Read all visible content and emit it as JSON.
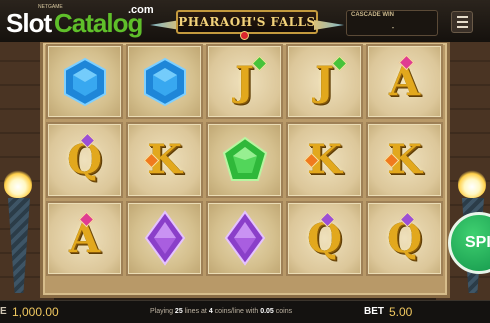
{
  "logo": {
    "word1": "Slot",
    "word2": "Catalog",
    "suffix": ".com",
    "tiny": "NETGAME"
  },
  "game": {
    "title": "PHARAOH'S FALLS"
  },
  "cascade": {
    "label": "CASCADE WIN",
    "value": "-"
  },
  "reels": [
    [
      {
        "symbol": "sapphire",
        "kind": "gem",
        "color": "#1e86d8"
      },
      {
        "symbol": "Q",
        "kind": "letter"
      },
      {
        "symbol": "A",
        "kind": "letter"
      }
    ],
    [
      {
        "symbol": "sapphire",
        "kind": "gem",
        "color": "#1e86d8"
      },
      {
        "symbol": "K",
        "kind": "letter"
      },
      {
        "symbol": "amethyst",
        "kind": "gem",
        "color": "#8a3fc9"
      }
    ],
    [
      {
        "symbol": "J",
        "kind": "letter"
      },
      {
        "symbol": "emerald",
        "kind": "gem",
        "color": "#2fb83a"
      },
      {
        "symbol": "amethyst",
        "kind": "gem",
        "color": "#8a3fc9"
      }
    ],
    [
      {
        "symbol": "J",
        "kind": "letter"
      },
      {
        "symbol": "K",
        "kind": "letter"
      },
      {
        "symbol": "Q",
        "kind": "letter"
      }
    ],
    [
      {
        "symbol": "A",
        "kind": "letter"
      },
      {
        "symbol": "K",
        "kind": "letter"
      },
      {
        "symbol": "Q",
        "kind": "letter"
      }
    ]
  ],
  "spin": {
    "label": "SPI"
  },
  "status": {
    "balance_label": "E",
    "balance": "1,000.00",
    "playing_prefix": "Playing",
    "lines": "25",
    "lines_text": "lines at",
    "coins": "4",
    "coins_text": "coins/line with",
    "coin_value": "0.05",
    "coin_suffix": "coins",
    "bet_label": "BET",
    "bet": "5.00"
  },
  "colors": {
    "accent_gold": "#f0c860",
    "spin_green": "#12944a"
  }
}
